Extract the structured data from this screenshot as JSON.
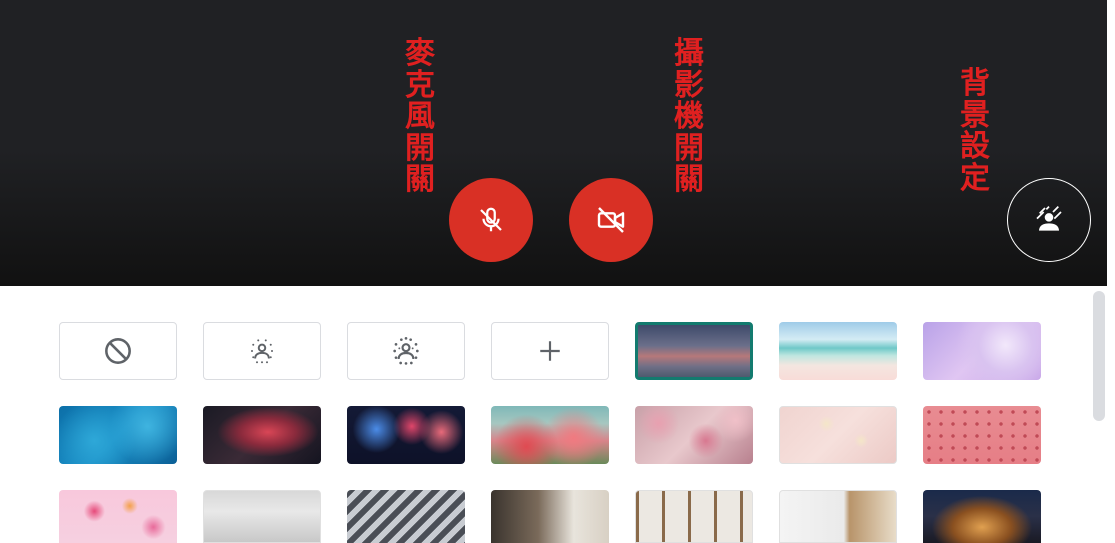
{
  "annotations": {
    "mic": "麥克風開關",
    "camera": "攝影機開關",
    "background": "背景設定"
  },
  "controls": {
    "mic_icon": "mic-off-icon",
    "camera_icon": "videocam-off-icon",
    "background_icon": "background-replace-icon",
    "mic_color": "#d93025",
    "camera_color": "#d93025"
  },
  "backgrounds": {
    "options": [
      "no-effect-icon",
      "slight-blur-icon",
      "blur-icon",
      "add-icon"
    ],
    "selected_index": 4
  },
  "colors": {
    "accent": "#137b6f",
    "preview_bg": "#202124"
  }
}
